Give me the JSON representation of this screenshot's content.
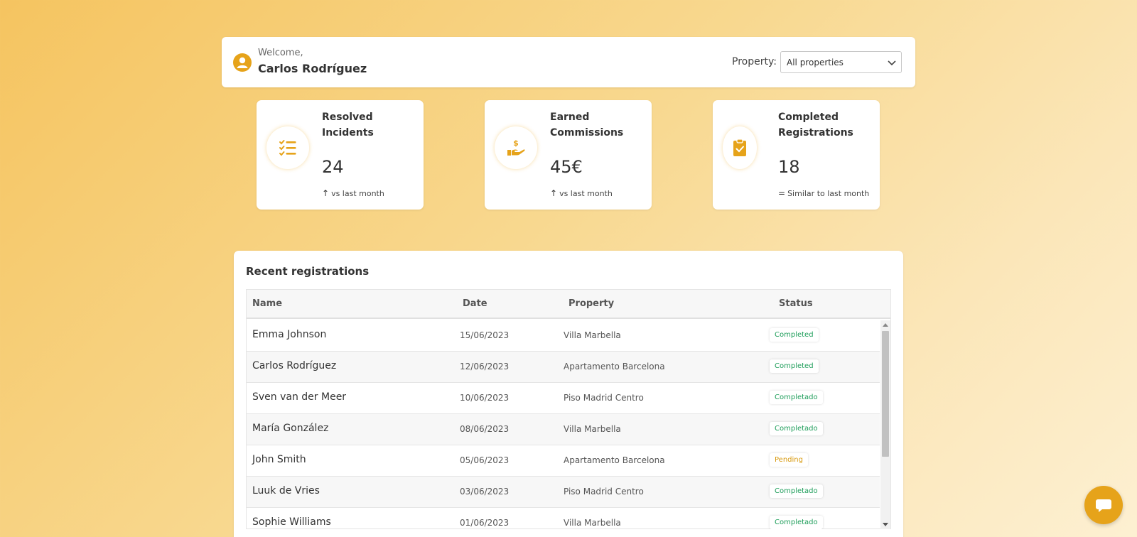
{
  "header": {
    "welcome_label": "Welcome,",
    "user_name": "Carlos Rodríguez",
    "property_label": "Property:",
    "property_selected": "All properties"
  },
  "kpis": [
    {
      "title": "Resolved Incidents",
      "value": "24",
      "trend_icon": "arrow-up-icon",
      "trend_text": "vs last month",
      "icon": "checklist-icon"
    },
    {
      "title": "Earned Commissions",
      "value": "45€",
      "trend_icon": "arrow-up-icon",
      "trend_text": "vs last month",
      "icon": "hand-money-icon"
    },
    {
      "title": "Completed Registrations",
      "value": "18",
      "trend_icon": "equals-icon",
      "trend_text": "Similar to last month",
      "icon": "clipboard-check-icon"
    }
  ],
  "registrations": {
    "title": "Recent registrations",
    "columns": [
      "Name",
      "Date",
      "Property",
      "Status"
    ],
    "rows": [
      {
        "name": "Emma Johnson",
        "date": "15/06/2023",
        "property": "Villa Marbella",
        "status": "Completed"
      },
      {
        "name": "Carlos Rodríguez",
        "date": "12/06/2023",
        "property": "Apartamento Barcelona",
        "status": "Completed"
      },
      {
        "name": "Sven van der Meer",
        "date": "10/06/2023",
        "property": "Piso Madrid Centro",
        "status": "Completado"
      },
      {
        "name": "María González",
        "date": "08/06/2023",
        "property": "Villa Marbella",
        "status": "Completado"
      },
      {
        "name": "John Smith",
        "date": "05/06/2023",
        "property": "Apartamento Barcelona",
        "status": "Pending"
      },
      {
        "name": "Luuk de Vries",
        "date": "03/06/2023",
        "property": "Piso Madrid Centro",
        "status": "Completado"
      },
      {
        "name": "Sophie Williams",
        "date": "01/06/2023",
        "property": "Villa Marbella",
        "status": "Completado"
      }
    ]
  },
  "colors": {
    "accent": "#e6a31a",
    "status_completed": "#1e9e5a",
    "status_pending": "#d89a10"
  },
  "chat": {
    "icon": "chat-bubble-icon"
  }
}
